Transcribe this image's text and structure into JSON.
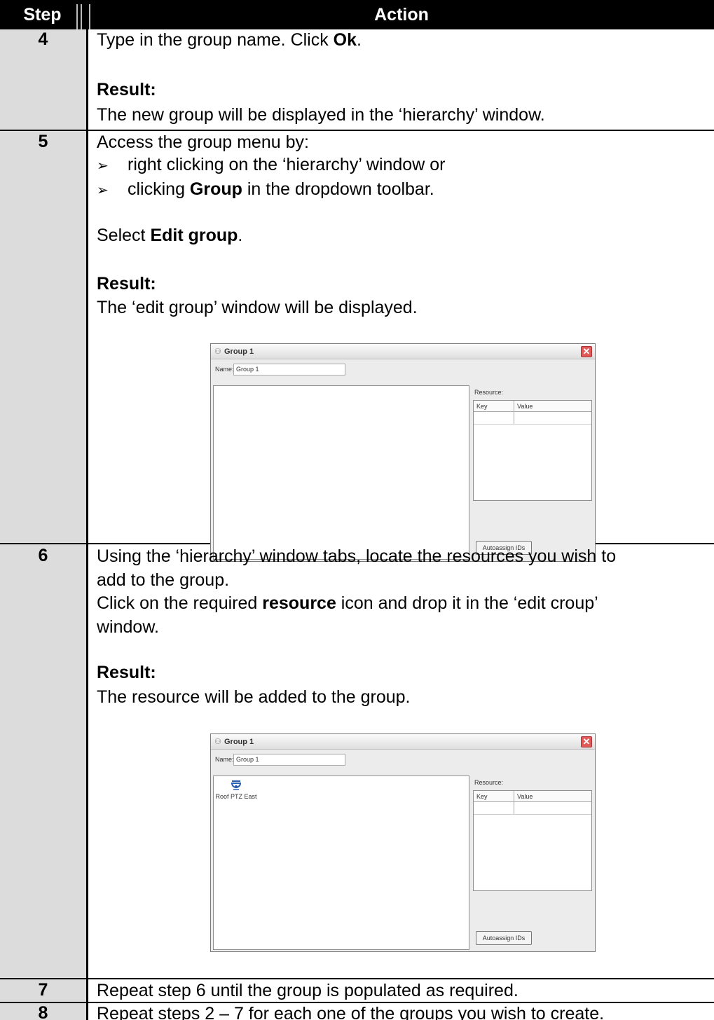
{
  "header": {
    "step": "Step",
    "action": "Action"
  },
  "rows": {
    "r4": {
      "step": "4",
      "line1_pre": "Type in the group name.  Click ",
      "line1_bold": "Ok",
      "line1_post": ".",
      "result_label": "Result:",
      "result_text": "The new group will be displayed in the ‘hierarchy’ window."
    },
    "r5": {
      "step": "5",
      "intro": "Access the group menu by:",
      "bullet1": "right clicking on the ‘hierarchy’ window or",
      "bullet2_pre": "clicking ",
      "bullet2_bold": "Group",
      "bullet2_post": " in the dropdown toolbar.",
      "select_pre": "Select ",
      "select_bold": "Edit group",
      "select_post": ".",
      "result_label": "Result:",
      "result_text": "The ‘edit group’ window will be displayed."
    },
    "r6": {
      "step": "6",
      "line1": "Using the ‘hierarchy’ window tabs, locate the resources you wish to",
      "line2": "add to the group.",
      "line3_pre": "Click on the required ",
      "line3_bold": "resource",
      "line3_post": " icon and drop it in the ‘edit croup’",
      "line4": "window.",
      "result_label": "Result:",
      "result_text": "The resource will be added to the group."
    },
    "r7": {
      "step": "7",
      "text": "Repeat step 6 until the group is populated as required."
    },
    "r8": {
      "step": "8",
      "text": "Repeat steps 2 – 7 for each one of the groups you wish to create."
    }
  },
  "dialog1": {
    "title": "Group 1",
    "name_label": "Name:",
    "name_value": "Group 1",
    "resource_label": "Resource:",
    "col_key": "Key",
    "col_value": "Value",
    "button": "Autoassign IDs"
  },
  "dialog2": {
    "title": "Group 1",
    "name_label": "Name:",
    "name_value": "Group 1",
    "resource_label": "Resource:",
    "col_key": "Key",
    "col_value": "Value",
    "button": "Autoassign IDs",
    "item_label": "Roof PTZ East",
    "item_icon": "ptz-camera-icon"
  },
  "icons": {
    "bullet": "➢",
    "close": "✕",
    "window": "group-icon"
  },
  "colors": {
    "header_bg": "#000000",
    "step_col_bg": "#dcdcdc",
    "close_btn": "#e05a5a"
  }
}
